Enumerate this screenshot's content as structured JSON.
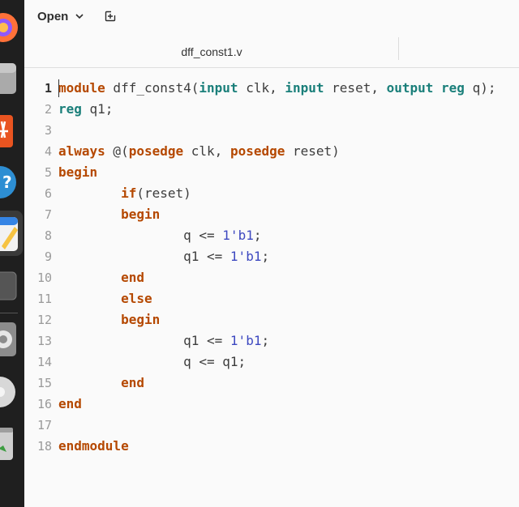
{
  "header": {
    "open_label": "Open"
  },
  "tabs": [
    {
      "label": "dff_const1.v"
    }
  ],
  "editor": {
    "lines": [
      {
        "n": "1",
        "tokens": [
          [
            "kw",
            "module"
          ],
          [
            "",
            " dff_const4("
          ],
          [
            "ty",
            "input"
          ],
          [
            "",
            " clk, "
          ],
          [
            "ty",
            "input"
          ],
          [
            "",
            " reset, "
          ],
          [
            "ty",
            "output"
          ],
          [
            "",
            " "
          ],
          [
            "ty",
            "reg"
          ],
          [
            "",
            " q);"
          ]
        ]
      },
      {
        "n": "2",
        "tokens": [
          [
            "ty",
            "reg"
          ],
          [
            "",
            " q1;"
          ]
        ]
      },
      {
        "n": "3",
        "tokens": []
      },
      {
        "n": "4",
        "tokens": [
          [
            "kw",
            "always"
          ],
          [
            "",
            " @("
          ],
          [
            "kw",
            "posedge"
          ],
          [
            "",
            " clk, "
          ],
          [
            "kw",
            "posedge"
          ],
          [
            "",
            " reset)"
          ]
        ]
      },
      {
        "n": "5",
        "tokens": [
          [
            "kw",
            "begin"
          ]
        ]
      },
      {
        "n": "6",
        "tokens": [
          [
            "",
            "        "
          ],
          [
            "kw",
            "if"
          ],
          [
            "",
            "(reset)"
          ]
        ]
      },
      {
        "n": "7",
        "tokens": [
          [
            "",
            "        "
          ],
          [
            "kw",
            "begin"
          ]
        ]
      },
      {
        "n": "8",
        "tokens": [
          [
            "",
            "                q <= "
          ],
          [
            "num",
            "1'b1"
          ],
          [
            "",
            ";"
          ]
        ]
      },
      {
        "n": "9",
        "tokens": [
          [
            "",
            "                q1 <= "
          ],
          [
            "num",
            "1'b1"
          ],
          [
            "",
            ";"
          ]
        ]
      },
      {
        "n": "10",
        "tokens": [
          [
            "",
            "        "
          ],
          [
            "kw",
            "end"
          ]
        ]
      },
      {
        "n": "11",
        "tokens": [
          [
            "",
            "        "
          ],
          [
            "kw",
            "else"
          ]
        ]
      },
      {
        "n": "12",
        "tokens": [
          [
            "",
            "        "
          ],
          [
            "kw",
            "begin"
          ]
        ]
      },
      {
        "n": "13",
        "tokens": [
          [
            "",
            "                q1 <= "
          ],
          [
            "num",
            "1'b1"
          ],
          [
            "",
            ";"
          ]
        ]
      },
      {
        "n": "14",
        "tokens": [
          [
            "",
            "                q <= q1;"
          ]
        ]
      },
      {
        "n": "15",
        "tokens": [
          [
            "",
            "        "
          ],
          [
            "kw",
            "end"
          ]
        ]
      },
      {
        "n": "16",
        "tokens": [
          [
            "kw",
            "end"
          ]
        ]
      },
      {
        "n": "17",
        "tokens": []
      },
      {
        "n": "18",
        "tokens": [
          [
            "kw",
            "endmodule"
          ]
        ]
      }
    ]
  },
  "colors": {
    "keyword": "#b54800",
    "type": "#1a7f7a",
    "number": "#3d48c0",
    "text": "#3d3d3d"
  }
}
